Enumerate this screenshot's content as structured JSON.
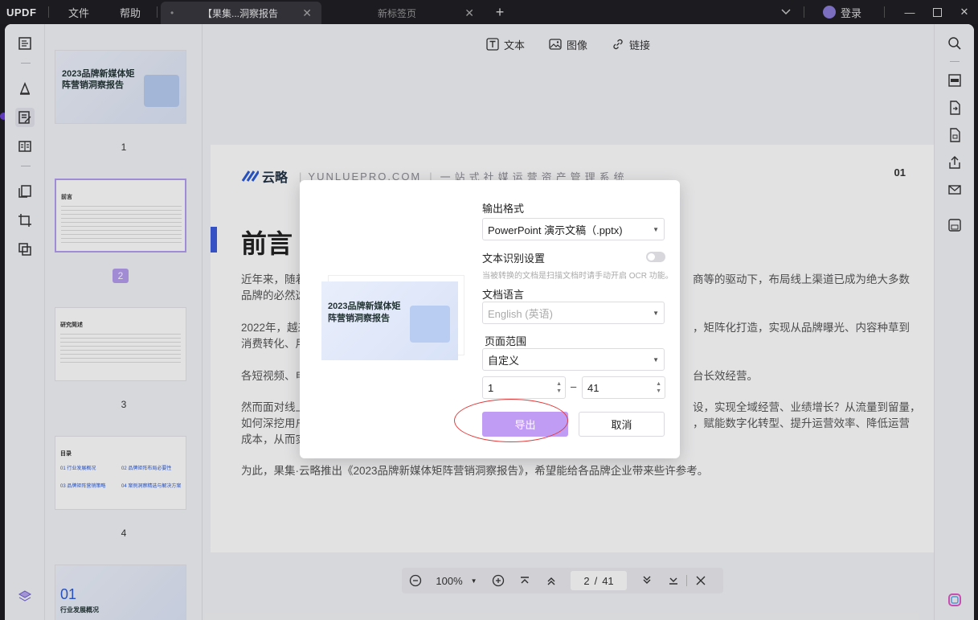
{
  "titlebar": {
    "logo": "UPDF",
    "menu": [
      "文件",
      "帮助"
    ],
    "tabs": [
      {
        "label": "【果集...洞察报告",
        "active": true
      },
      {
        "label": "新标签页",
        "active": false
      }
    ],
    "login": "登录"
  },
  "toolbar": {
    "text": "文本",
    "image": "图像",
    "link": "链接"
  },
  "thumbnails": {
    "pages": [
      "1",
      "2",
      "3",
      "4"
    ],
    "thumb1_title": "2023品牌新媒体矩阵营销洞察报告",
    "thumb2_heading": "前言",
    "thumb3_heading": "研究简述",
    "thumb4_heading": "目录",
    "thumb4_items": [
      "01 行业发展概况",
      "02 品牌矩阵布局必要性",
      "03 品牌矩阵营销策略",
      "04 案例洞察精选与解决方案"
    ],
    "thumb5_num": "01",
    "thumb5_text": "行业发展概况"
  },
  "document": {
    "brand": "云略",
    "site": "YUNLUEPRO.COM",
    "slogan": "一站式社媒运营资产管理系统",
    "page_no": "01",
    "title": "前言",
    "para1a": "近年来，随着",
    "para1b": "商等的驱动下，布局线上渠道已成为绝大多数",
    "para1c": "品牌的必然选",
    "para2a": "2022年，越来",
    "para2b": "，矩阵化打造，实现从品牌曝光、内容种草到",
    "para2c": "消费转化、用",
    "para3a": "各短视频、电",
    "para3b": "台长效经营。",
    "para4a": "然而面对线上",
    "para4b": "设，实现全域经营、业绩增长？从流量到留量，",
    "para4c": "如何深挖用户",
    "para4d": "，赋能数字化转型、提升运营效率、降低运营",
    "para4e": "成本，从而实",
    "para5": "为此，果集·云略推出《2023品牌新媒体矩阵营销洞察报告》，希望能给各品牌企业带来些许参考。"
  },
  "dialog": {
    "preview_title": "2023品牌新媒体矩阵营销洞察报告",
    "output_format_label": "输出格式",
    "output_format_value": "PowerPoint 演示文稿（.pptx)",
    "ocr_label": "文本识别设置",
    "ocr_hint": "当被转换的文档是扫描文档时请手动开启 OCR 功能。",
    "doc_lang_label": "文档语言",
    "doc_lang_value": "English (英语)",
    "page_range_label": "页面范围",
    "page_range_value": "自定义",
    "range_from": "1",
    "range_to": "41",
    "range_dash": "–",
    "export_button": "导出",
    "cancel_button": "取消"
  },
  "bottom_nav": {
    "zoom": "100%",
    "current_page": "2",
    "slash": "/",
    "total_pages": "41"
  },
  "colors": {
    "accent": "#c19cf5",
    "highlight": "#e23b3b",
    "title_bar": "#3b5bdb"
  }
}
